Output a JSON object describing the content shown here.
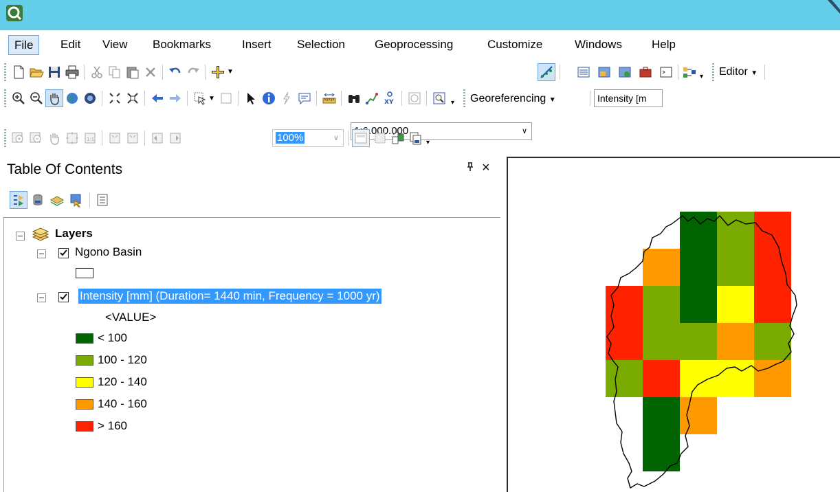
{
  "menu": {
    "items": [
      "File",
      "Edit",
      "View",
      "Bookmarks",
      "Insert",
      "Selection",
      "Geoprocessing",
      "Customize",
      "Windows",
      "Help"
    ]
  },
  "toolbar": {
    "scale_value": "1:6.000.000",
    "editor_label": "Editor",
    "georeferencing_label": "Georeferencing",
    "georef_layer_value": "Intensity [m",
    "zoom_value": "100%"
  },
  "toc": {
    "title": "Table Of Contents",
    "pin_glyph": "ᵖ",
    "close_glyph": "×",
    "layers_label": "Layers",
    "basin_layer": "Ngono Basin",
    "raster_layer": "Intensity [mm] (Duration= 1440 min, Frequency = 1000 yr)",
    "value_label": "<VALUE>",
    "legend": [
      {
        "label": "< 100",
        "color": "#006400"
      },
      {
        "label": "100 - 120",
        "color": "#7aab00"
      },
      {
        "label": "120 - 140",
        "color": "#ffff00"
      },
      {
        "label": "140 - 160",
        "color": "#ff9900"
      },
      {
        "label": "> 160",
        "color": "#ff2200"
      }
    ]
  },
  "map": {
    "grid": [
      {
        "col": 2,
        "row": 0,
        "cls": 0
      },
      {
        "col": 3,
        "row": 0,
        "cls": 1
      },
      {
        "col": 4,
        "row": 0,
        "cls": 4
      },
      {
        "col": 1,
        "row": 1,
        "cls": 3
      },
      {
        "col": 2,
        "row": 1,
        "cls": 0
      },
      {
        "col": 3,
        "row": 1,
        "cls": 1
      },
      {
        "col": 4,
        "row": 1,
        "cls": 4
      },
      {
        "col": 0,
        "row": 2,
        "cls": 4
      },
      {
        "col": 1,
        "row": 2,
        "cls": 1
      },
      {
        "col": 2,
        "row": 2,
        "cls": 0
      },
      {
        "col": 3,
        "row": 2,
        "cls": 2
      },
      {
        "col": 4,
        "row": 2,
        "cls": 4
      },
      {
        "col": 0,
        "row": 3,
        "cls": 4
      },
      {
        "col": 1,
        "row": 3,
        "cls": 1
      },
      {
        "col": 2,
        "row": 3,
        "cls": 1
      },
      {
        "col": 3,
        "row": 3,
        "cls": 3
      },
      {
        "col": 4,
        "row": 3,
        "cls": 1
      },
      {
        "col": 0,
        "row": 4,
        "cls": 1
      },
      {
        "col": 1,
        "row": 4,
        "cls": 4
      },
      {
        "col": 2,
        "row": 4,
        "cls": 2
      },
      {
        "col": 3,
        "row": 4,
        "cls": 2
      },
      {
        "col": 4,
        "row": 4,
        "cls": 3
      },
      {
        "col": 1,
        "row": 5,
        "cls": 0
      },
      {
        "col": 2,
        "row": 5,
        "cls": 3
      },
      {
        "col": 1,
        "row": 6,
        "cls": 0
      }
    ]
  }
}
